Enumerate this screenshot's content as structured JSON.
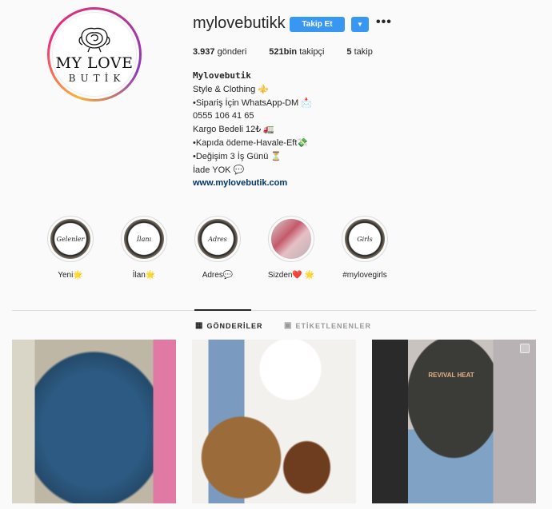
{
  "profile": {
    "username": "mylovebutikk",
    "follow_label": "Takip Et",
    "more_label": "•••",
    "logo_main": "MY LOVE",
    "logo_sub": "BUTİK",
    "stats": [
      {
        "value": "3.937",
        "label": " gönderi"
      },
      {
        "value": "521bin",
        "label": " takipçi"
      },
      {
        "value": "5",
        "label": " takip"
      }
    ],
    "bio": {
      "name": "Mylovebutik",
      "lines": [
        "Style & Clothing ⚜️",
        "•Sipariş İçin WhatsApp-DM 📩",
        "0555 106 41 65",
        "Kargo Bedeli 12₺ 🚛",
        "•Kapıda ödeme-Havale-Eft💸",
        "•Değişim 3 İş Günü ⏳",
        "İade YOK 💬"
      ],
      "link": "www.mylovebutik.com"
    }
  },
  "highlights": [
    {
      "label": "Yeni🌟",
      "cover_text": "Gelenler"
    },
    {
      "label": "İlan🌟",
      "cover_text": "İlanı"
    },
    {
      "label": "Adres💬",
      "cover_text": "Adres"
    },
    {
      "label": "Sizden❤️ 🌟",
      "cover_text": ""
    },
    {
      "label": "#mylovegirls",
      "cover_text": "Girls"
    }
  ],
  "tabs": [
    {
      "label": "GÖNDERİLER",
      "icon": "grid-icon"
    },
    {
      "label": "ETİKETLENENLER",
      "icon": "tagged-icon"
    }
  ],
  "post3_print": "REVIVAL HEAT"
}
